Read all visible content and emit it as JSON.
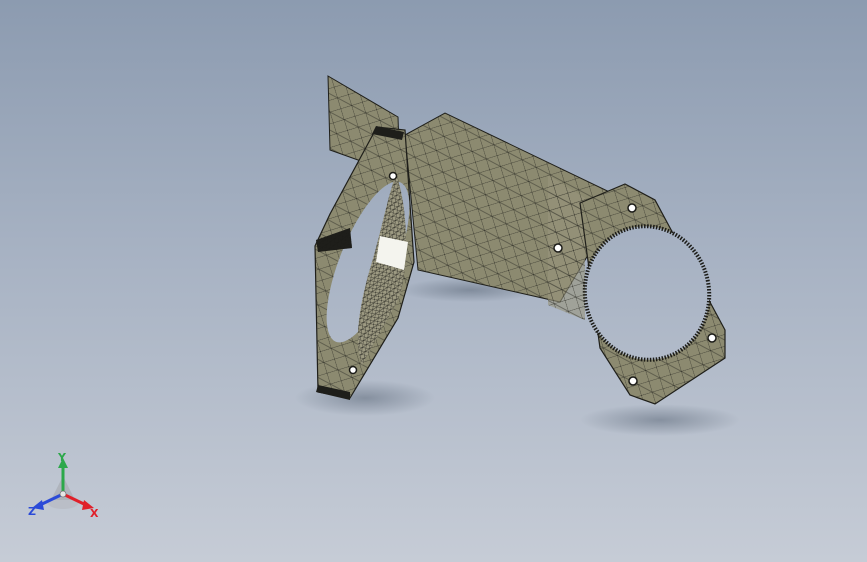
{
  "viewport": {
    "background_top": "#8c9bb0",
    "background_bottom": "#c6ccd6"
  },
  "model": {
    "display_mode": "mesh",
    "face_color": "#8c8a70",
    "mesh_color": "#2a2a24"
  },
  "triad": {
    "x_label": "X",
    "y_label": "Y",
    "z_label": "Z",
    "x_color": "#e0202a",
    "y_color": "#2ca84a",
    "z_color": "#2a4ad8"
  }
}
